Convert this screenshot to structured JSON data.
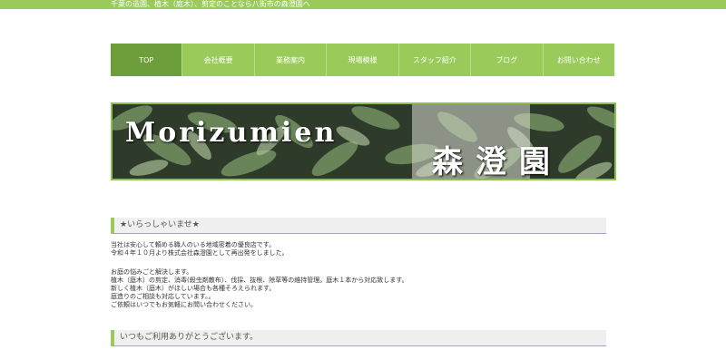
{
  "topbar": {
    "tagline": "千葉の造園、植木（庭木）、剪定のことなら八街市の森澄園へ"
  },
  "nav": {
    "items": [
      {
        "label": "TOP"
      },
      {
        "label": "会社概要"
      },
      {
        "label": "業務案内"
      },
      {
        "label": "現場模様"
      },
      {
        "label": "スタッフ紹介"
      },
      {
        "label": "ブログ"
      },
      {
        "label": "お問い合わせ"
      }
    ]
  },
  "banner": {
    "title_en": "Morizumien",
    "title_jp": "森澄園"
  },
  "welcome": {
    "heading": "★いらっしゃいませ★",
    "para1": [
      "当社は安心して頼める職人のいる地域密着の優良店です。",
      "令和４年１０月より株式会社森澄園として再出発をしました。"
    ],
    "para2": [
      "お庭の悩みごと解決します。",
      "植木（庭木）の剪定、消毒(殺虫剤散布）、伐採、抜根、除草等の維持管理。庭木１本から対応致します。",
      "新しく植木（庭木）がほしい場合も各種そろえられます。",
      "庭造りのご相談も対応しています。。",
      "ご依頼はいつでもお気軽にお問い合わせください。"
    ]
  },
  "thanks": {
    "heading": "いつもご利用ありがとうございます。"
  },
  "colors": {
    "accent": "#9acb5a",
    "nav_active": "#6d9e3c"
  }
}
